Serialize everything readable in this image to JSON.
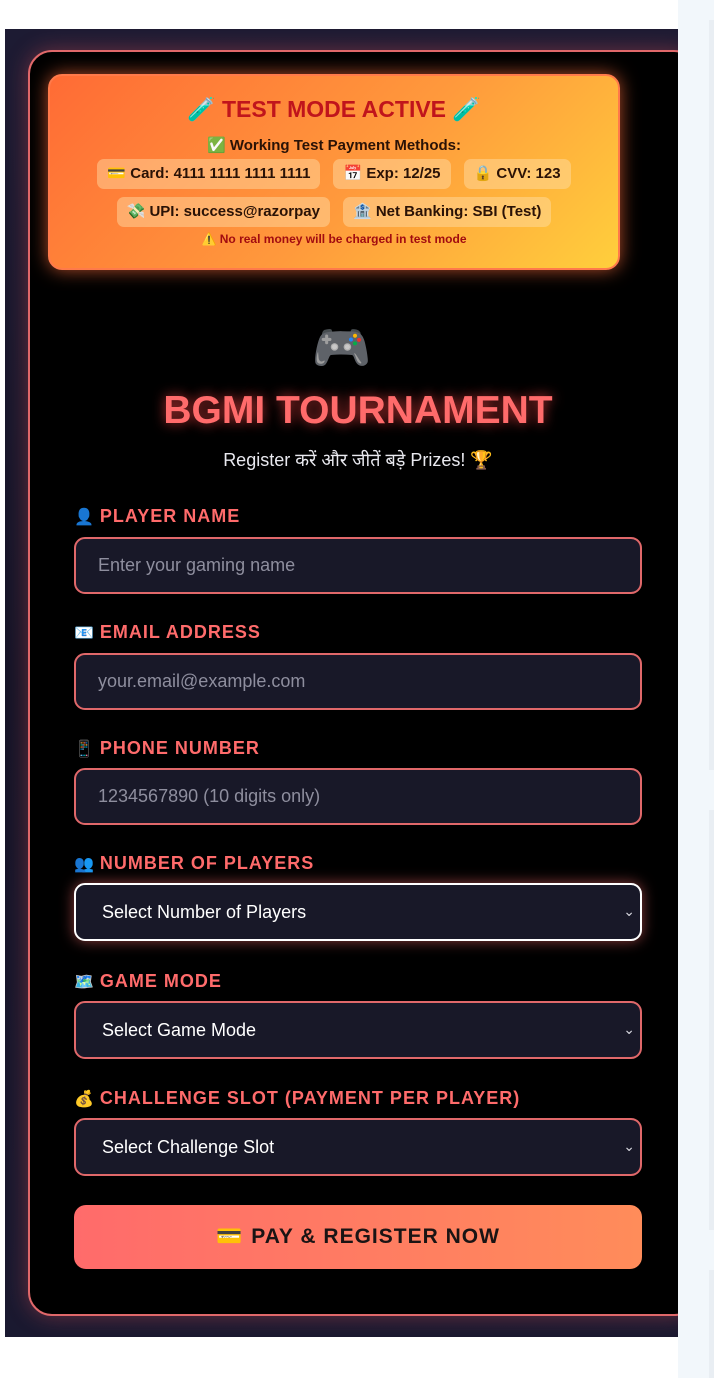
{
  "banner": {
    "title": "🧪 TEST MODE ACTIVE 🧪",
    "subtitle": "✅ Working Test Payment Methods:",
    "chips_row1": [
      "💳 Card: 4111 1111 1111 1111",
      "📅 Exp: 12/25",
      "🔒 CVV: 123"
    ],
    "chips_row2": [
      "💸 UPI: success@razorpay",
      "🏦 Net Banking: SBI (Test)"
    ],
    "warning": "⚠️ No real money will be charged in test mode"
  },
  "header": {
    "icon": "🎮",
    "title": "BGMI TOURNAMENT",
    "subtitle": "Register करें और जीतें बड़े Prizes! 🏆"
  },
  "form": {
    "player_name": {
      "icon": "👤",
      "label": "Player Name",
      "placeholder": "Enter your gaming name",
      "value": ""
    },
    "email": {
      "icon": "📧",
      "label": "Email Address",
      "placeholder": "your.email@example.com",
      "value": ""
    },
    "phone": {
      "icon": "📱",
      "label": "Phone Number",
      "placeholder": "1234567890 (10 digits only)",
      "value": ""
    },
    "players": {
      "icon": "👥",
      "label": "Number of Players",
      "selected": "Select Number of Players"
    },
    "game_mode": {
      "icon": "🗺️",
      "label": "Game Mode",
      "selected": "Select Game Mode"
    },
    "challenge_slot": {
      "icon": "💰",
      "label": "Challenge Slot (Payment per Player)",
      "selected": "Select Challenge Slot"
    },
    "submit": {
      "icon": "💳",
      "label": "Pay & Register Now"
    }
  },
  "colors": {
    "accent": "#ff6b6b",
    "card_border": "#e0686a",
    "banner_start": "#ff6b35",
    "banner_end": "#ffcf3c",
    "field_bg": "#181828"
  },
  "icons": {
    "chevron": "chevron-down-icon"
  }
}
